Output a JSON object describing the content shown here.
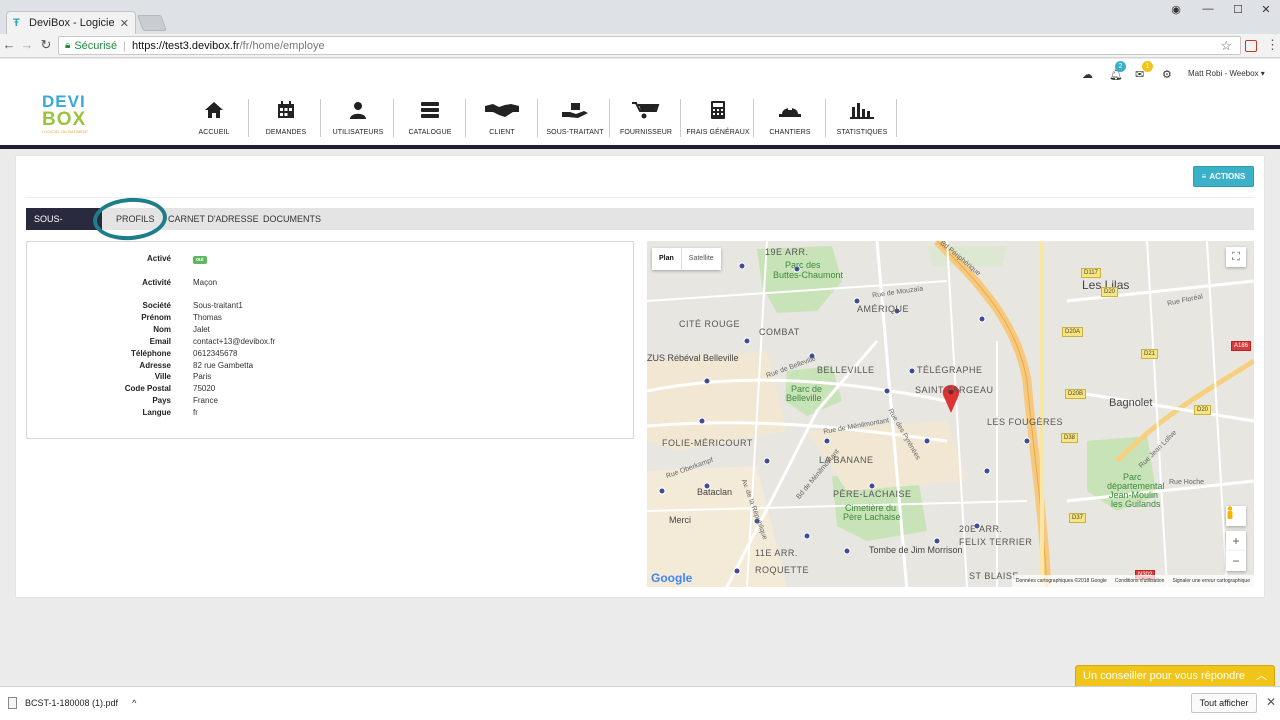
{
  "browser": {
    "tab_title": "DeviBox - Logiciel du bat",
    "secure_label": "Sécurisé",
    "url_host": "https://test3.devibox.fr",
    "url_path": "/fr/home/employe"
  },
  "topbar": {
    "notif_count": "2",
    "mail_count": "1",
    "user_label": "Matt Robi - Weebox"
  },
  "logo": {
    "line1": "DEVI",
    "line2": "BOX",
    "tagline": "LOGICIEL DU BATIMENT"
  },
  "nav": [
    {
      "label": "ACCUEIL",
      "icon": "home-icon"
    },
    {
      "label": "DEMANDES",
      "icon": "calendar-icon"
    },
    {
      "label": "UTILISATEURS",
      "icon": "user-icon"
    },
    {
      "label": "CATALOGUE",
      "icon": "server-icon"
    },
    {
      "label": "CLIENT",
      "icon": "handshake-icon"
    },
    {
      "label": "SOUS-TRAITANT",
      "icon": "hand-holding-icon"
    },
    {
      "label": "FOURNISSEUR",
      "icon": "wheelbarrow-icon"
    },
    {
      "label": "FRAIS GÉNÉRAUX",
      "icon": "calculator-icon"
    },
    {
      "label": "CHANTIERS",
      "icon": "hardhat-icon"
    },
    {
      "label": "STATISTIQUES",
      "icon": "bar-chart-icon"
    }
  ],
  "actions_label": "ACTIONS",
  "tabs": [
    "SOUS-TRAITANT",
    "PROFILS",
    "CARNET D'ADRESSE",
    "DOCUMENTS"
  ],
  "details": {
    "actif_label": "Activé",
    "actif_value": "oui",
    "activite_label": "Activité",
    "activite_value": "Maçon",
    "fields": [
      {
        "label": "Société",
        "value": "Sous-traitant1"
      },
      {
        "label": "Prénom",
        "value": "Thomas"
      },
      {
        "label": "Nom",
        "value": "Jalet"
      },
      {
        "label": "Email",
        "value": "contact+13@devibox.fr"
      },
      {
        "label": "Téléphone",
        "value": "0612345678"
      },
      {
        "label": "Adresse",
        "value": "82 rue Gambetta"
      },
      {
        "label": "Ville",
        "value": "Paris"
      },
      {
        "label": "Code Postal",
        "value": "75020"
      },
      {
        "label": "Pays",
        "value": "France"
      },
      {
        "label": "Langue",
        "value": "fr"
      }
    ]
  },
  "map": {
    "type_plan": "Plan",
    "type_satellite": "Satellite",
    "labels": {
      "arr19": "19E ARR.",
      "buttes1": "Parc des",
      "buttes2": "Buttes-Chaumont",
      "amerique": "AMÉRIQUE",
      "lilas": "Les Lilas",
      "citerouge": "CITÉ ROUGE",
      "combat": "COMBAT",
      "zus": "ZUS Rébéval Belleville",
      "belleville": "BELLEVILLE",
      "telegraphe": "TÉLÉGRAPHE",
      "saintfargeau": "SAINT-FARGEAU",
      "parcbelleville1": "Parc de",
      "parcbelleville2": "Belleville",
      "bagnolet": "Bagnolet",
      "fougeres": "LES FOUGÈRES",
      "folie": "FOLIE-MÉRICOURT",
      "labanane": "LA BANANE",
      "parcdep1": "Parc",
      "parcdep2": "départemental",
      "parcdep3": "Jean-Moulin",
      "parcdep4": "les Guilands",
      "bataclan": "Bataclan",
      "perelachaise": "PÈRE-LACHAISE",
      "merci": "Merci",
      "cimetiere1": "Cimetière du",
      "cimetiere2": "Père Lachaise",
      "arr20": "20E ARR.",
      "felix": "FELIX TERRIER",
      "arr11": "11E ARR.",
      "morrison": "Tombe de Jim Morrison",
      "roquette": "ROQUETTE",
      "stblaise": "ST BLAISE",
      "bdperi": "Bd Périphérique",
      "rueMouzaia": "Rue de Mouzaïa",
      "rueBelleville": "Rue de Belleville",
      "rueMenilmontant": "Rue de Ménilmontant",
      "ruePyrenees": "Rue des Pyrénées",
      "rueOberkampf": "Rue Oberkampf",
      "rueFloreal": "Rue Floréal",
      "rueLolive": "Rue Jean Lolive",
      "rueHoche": "Rue Hoche",
      "avRepublique": "Av. de la République",
      "bdMenilmontant": "Bd de Ménilmontant"
    },
    "roads": [
      "D117",
      "D20",
      "D20A",
      "A186",
      "D21",
      "D20B",
      "D38",
      "D37",
      "N302",
      "D20"
    ],
    "footer_data": "Données cartographiques ©2018 Google",
    "footer_terms": "Conditions d'utilisation",
    "footer_report": "Signaler une erreur cartographique",
    "google": "Google"
  },
  "chat": {
    "label": "Un conseiller pour vous répondre"
  },
  "downloads": {
    "file": "BCST-1-180008 (1).pdf",
    "show_all": "Tout afficher"
  },
  "colors": {
    "accent": "#3bb0c9",
    "dark_nav": "#1f1f33",
    "circle": "#1e7d8a",
    "chat": "#f0c419"
  }
}
